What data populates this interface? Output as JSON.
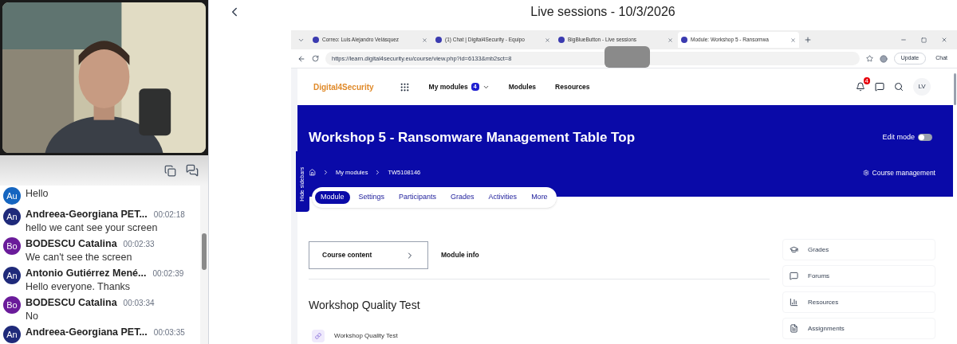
{
  "chat": [
    {
      "initials": "Au",
      "color": "#1565c0",
      "message": "Hello"
    },
    {
      "initials": "An",
      "color": "#1f2a7a",
      "name": "Andreea-Georgiana PET...",
      "time": "00:02:18",
      "message": "hello we cant see your screen"
    },
    {
      "initials": "Bo",
      "color": "#6a1b9a",
      "name": "BODESCU Catalina",
      "time": "00:02:33",
      "message": "We can't see the screen"
    },
    {
      "initials": "An",
      "color": "#1f2a7a",
      "name": "Antonio Gutiérrez Mené...",
      "time": "00:02:39",
      "message": "Hello everyone. Thanks"
    },
    {
      "initials": "Bo",
      "color": "#6a1b9a",
      "name": "BODESCU Catalina",
      "time": "00:03:34",
      "message": "No"
    },
    {
      "initials": "An",
      "color": "#1f2a7a",
      "name": "Andreea-Georgiana PET...",
      "time": "00:03:35"
    }
  ],
  "header": {
    "title": "Live sessions - 10/3/2026"
  },
  "browser": {
    "tabs": [
      {
        "label": "Correo: Luis Alejandro Velásquez",
        "selected": false
      },
      {
        "label": "(1) Chat | Digital4Security - Equipo",
        "selected": false
      },
      {
        "label": "BigBlueButton - Live sessions",
        "selected": false
      },
      {
        "label": "Module: Workshop 5 - Ransomwa",
        "selected": true
      }
    ],
    "url": "https://learn.digital4security.eu/course/view.php?id=6133&mb2sct=8",
    "update_button": "Update",
    "chat_button": "Chat"
  },
  "site": {
    "logo": "Digital4Security",
    "nav": [
      {
        "label": "My modules",
        "badge": "4"
      },
      {
        "label": "Modules"
      },
      {
        "label": "Resources"
      }
    ],
    "notification_count": "4",
    "user_initials": "LV",
    "course_title": "Workshop 5 - Ransomware Management Table Top",
    "edit_mode": {
      "label": "Edit mode",
      "on": false
    },
    "breadcrumb": [
      "My modules",
      "TW5108146"
    ],
    "course_management": "Course management",
    "hide_sidebars": "Hide sidebars",
    "tabs": [
      {
        "label": "Module",
        "selected": true
      },
      {
        "label": "Settings",
        "selected": false
      },
      {
        "label": "Participants",
        "selected": false
      },
      {
        "label": "Grades",
        "selected": false
      },
      {
        "label": "Activities",
        "selected": false
      },
      {
        "label": "More",
        "selected": false
      }
    ],
    "course_content_button": "Course content",
    "module_info": "Module info",
    "section_title": "Workshop Quality Test",
    "activities": [
      {
        "label": "Workshop Quality Test"
      }
    ],
    "sidebar": [
      {
        "kind": "grades",
        "label": "Grades"
      },
      {
        "kind": "forums",
        "label": "Forums"
      },
      {
        "kind": "resources",
        "label": "Resources"
      },
      {
        "kind": "assignments",
        "label": "Assignments"
      }
    ]
  }
}
